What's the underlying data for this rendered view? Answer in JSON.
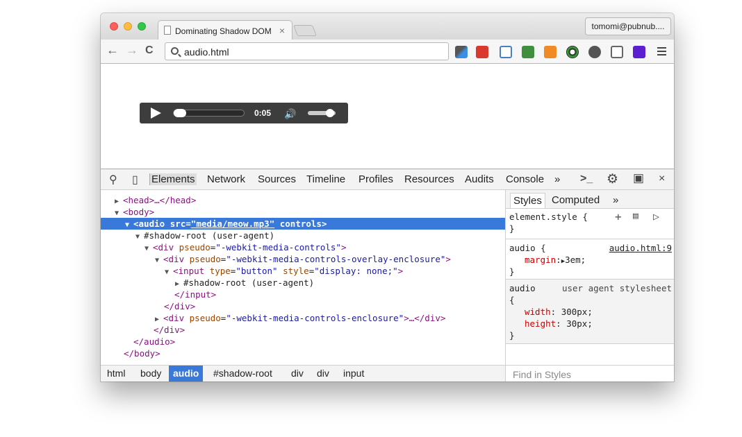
{
  "window": {
    "tab_title": "Dominating Shadow DOM",
    "tab_close": "×",
    "profile": "tomomi@pubnub...."
  },
  "toolbar": {
    "url": "audio.html",
    "back": "←",
    "forward": "→",
    "reload": "C"
  },
  "audio_player": {
    "time": "0:05",
    "speaker": "🔊",
    "progress": 0.0,
    "volume": 0.8
  },
  "devtools": {
    "tabs": [
      "Elements",
      "Network",
      "Sources",
      "Timeline",
      "Profiles",
      "Resources",
      "Audits",
      "Console"
    ],
    "more": "»",
    "close": "×",
    "dom": [
      {
        "text_tag": "<head>…</head>",
        "tri": "▶"
      },
      {
        "text_tag": "<body>",
        "tri": "▼"
      },
      {
        "tag_open": "<audio ",
        "attr1": "src",
        "val1": "\"media/meow.mp3\"",
        "attr2": " controls",
        "tag_close": ">",
        "tri": "▼"
      },
      {
        "plain": "#shadow-root (user-agent)",
        "tri": "▼"
      },
      {
        "tag_open": "<div ",
        "attr1": "pseudo",
        "val1": "\"-webkit-media-controls\"",
        "tag_close": ">",
        "tri": "▼"
      },
      {
        "tag_open": "<div ",
        "attr1": "pseudo",
        "val1": "\"-webkit-media-controls-overlay-enclosure\"",
        "tag_close": ">",
        "tri": "▼"
      },
      {
        "tag_open": "<input ",
        "attr1": "type",
        "val1": "\"button\"",
        "attr2": "style",
        "val2": "\"display: none;\"",
        "tag_close": ">",
        "tri": "▼"
      },
      {
        "plain": "#shadow-root (user-agent)",
        "tri": "▶"
      },
      {
        "text_tag": "</input>"
      },
      {
        "text_tag": "</div>"
      },
      {
        "tag_open": "<div ",
        "attr1": "pseudo",
        "val1": "\"-webkit-media-controls-enclosure\"",
        "tag_close": ">…</div>",
        "tri": "▶"
      },
      {
        "text_tag": "</div>"
      },
      {
        "text_tag": "</audio>"
      },
      {
        "text_tag": "</body>"
      }
    ],
    "breadcrumbs": [
      "html",
      "body",
      "audio",
      "#shadow-root",
      "div",
      "div",
      "input"
    ],
    "sidebar": {
      "tabs": [
        "Styles",
        "Computed"
      ],
      "more": "»",
      "element_style": "element.style {",
      "element_style_close": "}",
      "rule1": {
        "selector": "audio {",
        "source": "audio.html:9",
        "prop": "margin",
        "value": "3em;",
        "close": "}"
      },
      "rule2": {
        "selector": "audio",
        "source": "user agent stylesheet",
        "open": "{",
        "props": [
          {
            "prop": "width",
            "value": "300px;"
          },
          {
            "prop": "height",
            "value": "30px;"
          }
        ],
        "close": "}"
      },
      "find": "Find in Styles"
    }
  },
  "colors": {
    "selection": "#3879d9",
    "tag": "#881280",
    "attr": "#994500",
    "value": "#1a1aa6",
    "css_prop": "#c80000"
  }
}
